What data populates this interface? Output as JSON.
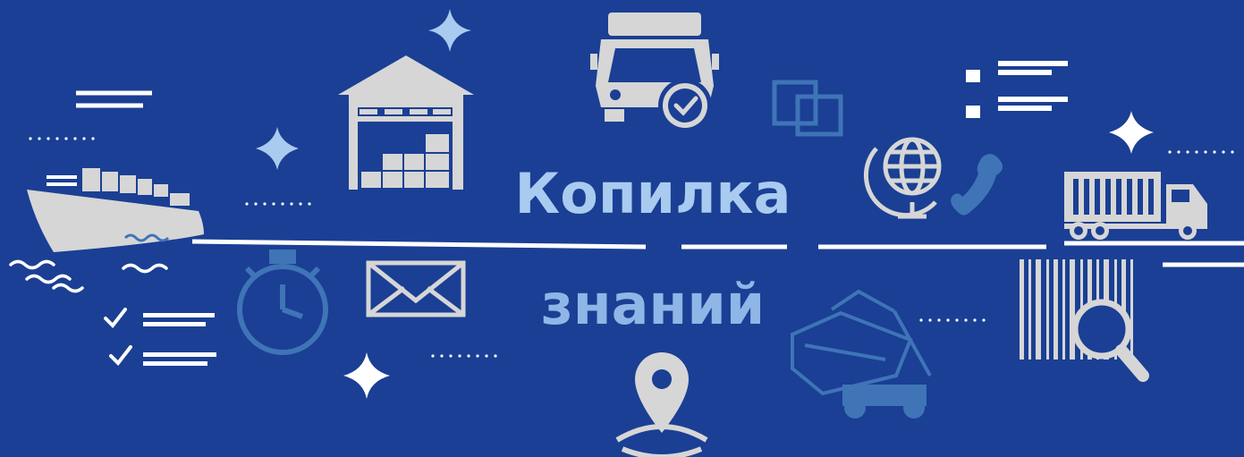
{
  "banner": {
    "title_line_1": "Копилка",
    "title_line_2": "знаний"
  },
  "colors": {
    "background": "#1a3f94",
    "title_line_1": "#a9cbf0",
    "title_line_2": "#8fb6e6",
    "icon_light": "#d6d6d6",
    "icon_blue": "#3f74b7",
    "white": "#ffffff"
  },
  "icons": [
    "cargo-ship-icon",
    "warehouse-icon",
    "delivery-truck-icon",
    "copy-squares-icon",
    "checklist-icon",
    "sparkle-icon",
    "globe-icon",
    "phone-icon",
    "container-truck-icon",
    "stopwatch-icon",
    "envelope-icon",
    "location-pin-icon",
    "crane-loader-icon",
    "barcode-search-icon",
    "checkmark-list-icon"
  ]
}
